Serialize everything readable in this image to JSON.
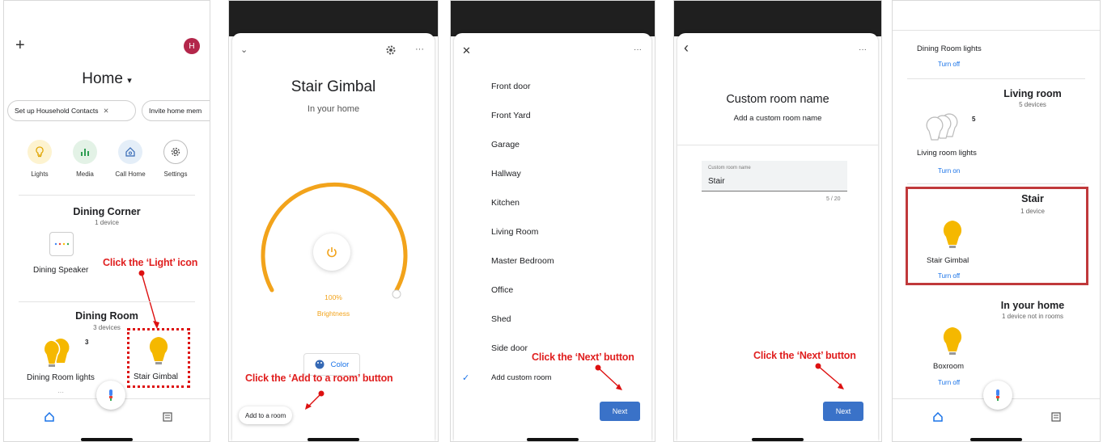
{
  "panel1": {
    "title": "Home",
    "title_caret": "▾",
    "avatar_letter": "H",
    "plus": "+",
    "chips": [
      "Set up Household Contacts",
      "Invite home mem"
    ],
    "chip_close": "✕",
    "quick_actions": [
      {
        "label": "Lights",
        "icon": "lightbulb-icon"
      },
      {
        "label": "Media",
        "icon": "bar-chart-icon"
      },
      {
        "label": "Call Home",
        "icon": "call-home-icon"
      },
      {
        "label": "Settings",
        "icon": "gear-icon"
      }
    ],
    "room1": {
      "title": "Dining Corner",
      "sub": "1 device",
      "device": "Dining Speaker"
    },
    "room2": {
      "title": "Dining Room",
      "sub": "3 devices",
      "device1": "Dining Room lights",
      "device1_count": "3",
      "device2": "Stair Gimbal"
    },
    "annotation": "Click the ‘Light’ icon"
  },
  "panel2": {
    "title": "Stair Gimbal",
    "subtitle": "In your home",
    "brightness_value": "100%",
    "brightness_label": "Brightness",
    "brightness_level": 1.0,
    "color_button": "Color",
    "add_room_button": "Add to a room",
    "annotation": "Click the ‘Add to a room’ button",
    "more": "···"
  },
  "panel3": {
    "rooms": [
      "Front door",
      "Front Yard",
      "Garage",
      "Hallway",
      "Kitchen",
      "Living Room",
      "Master Bedroom",
      "Office",
      "Shed",
      "Side door"
    ],
    "custom": "Add custom room",
    "next_button": "Next",
    "annotation": "Click the ‘Next’ button",
    "close": "✕",
    "more": "···"
  },
  "panel4": {
    "title": "Custom room name",
    "subtitle": "Add a custom room name",
    "field_label": "Custom room name",
    "field_value": "Stair",
    "counter": "5 / 20",
    "next_button": "Next",
    "annotation": "Click the ‘Next’ button",
    "back": "‹",
    "more": "···"
  },
  "panel5": {
    "top_device": "Dining Room lights",
    "top_action": "Turn off",
    "living": {
      "title": "Living room",
      "sub": "5 devices",
      "count": "5",
      "device": "Living room lights",
      "action": "Turn on"
    },
    "stair": {
      "title": "Stair",
      "sub": "1 device",
      "device": "Stair Gimbal",
      "action": "Turn off"
    },
    "home": {
      "title": "In your home",
      "sub": "1 device not in rooms",
      "device": "Boxroom",
      "action": "Turn off"
    }
  },
  "colors": {
    "accent_blue": "#1a73e8",
    "button_blue": "#3a72c8",
    "annotation_red": "#e02020",
    "bulb_yellow": "#f5b800",
    "dial_orange": "#f2a31b"
  }
}
